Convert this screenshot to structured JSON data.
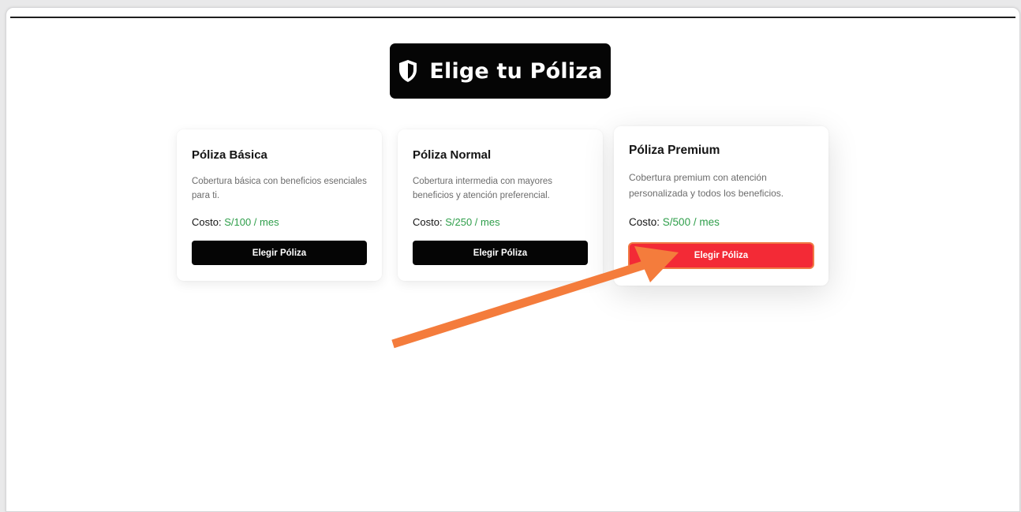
{
  "header": {
    "title": "Elige tu Póliza",
    "icon": "shield-icon"
  },
  "plans": [
    {
      "name": "Póliza Básica",
      "description": "Cobertura básica con beneficios esenciales para ti.",
      "cost_label": "Costo:",
      "cost_value": "S/100 / mes",
      "button_label": "Elegir Póliza"
    },
    {
      "name": "Póliza Normal",
      "description": "Cobertura intermedia con mayores beneficios y atención preferencial.",
      "cost_label": "Costo:",
      "cost_value": "S/250 / mes",
      "button_label": "Elegir Póliza"
    },
    {
      "name": "Póliza Premium",
      "description": "Cobertura premium con atención personalizada y todos los beneficios.",
      "cost_label": "Costo:",
      "cost_value": "S/500 / mes",
      "button_label": "Elegir Póliza"
    }
  ],
  "colors": {
    "banner": "#050505",
    "price": "#2e9e4a",
    "highlight_button": "#f32a36",
    "annotation_arrow": "#f47c3c"
  },
  "annotation": {
    "type": "arrow",
    "target": "premium-choose-button"
  }
}
